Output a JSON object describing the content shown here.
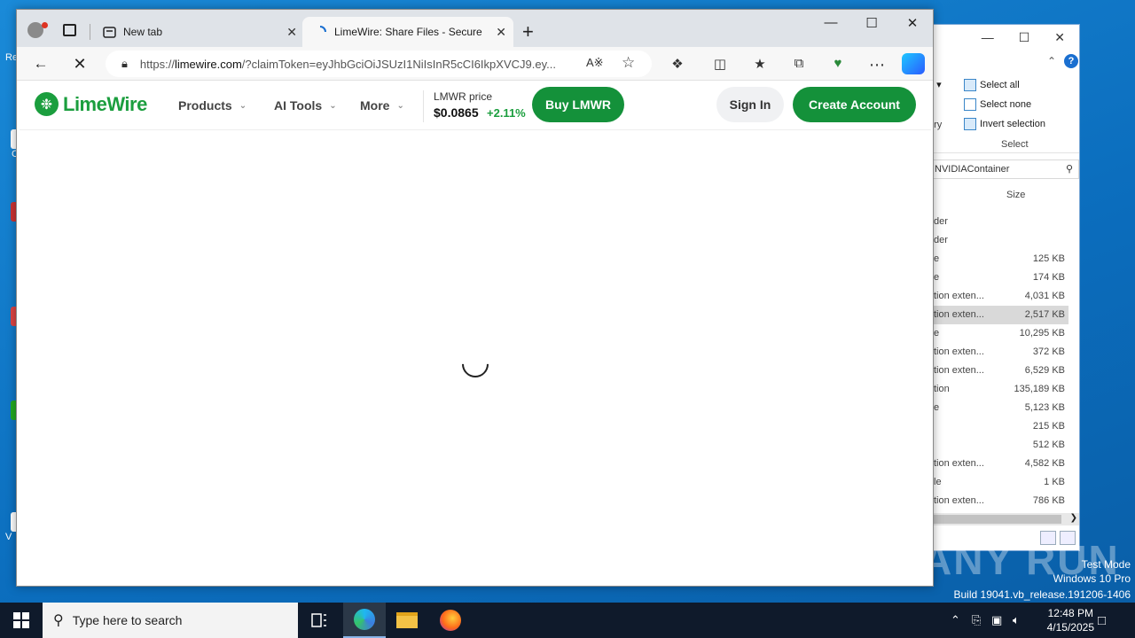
{
  "desktop": {
    "fragments": [
      "Re",
      "C",
      "V"
    ],
    "watermark": "ANY RUN",
    "sysinfo": [
      "Test Mode",
      "Windows 10 Pro",
      "Build 19041.vb_release.191206-1406"
    ]
  },
  "explorer": {
    "ribbon": {
      "dropdown_frag": "n ▾",
      "history_frag": "ory",
      "select_all": "Select all",
      "select_none": "Select none",
      "invert_selection": "Invert selection",
      "group_caption": "Select"
    },
    "search_value": "NVIDIAContainer",
    "size_header": "Size",
    "rows": [
      {
        "type": "der",
        "size": ""
      },
      {
        "type": "der",
        "size": ""
      },
      {
        "type": "e",
        "size": "125 KB"
      },
      {
        "type": "e",
        "size": "174 KB"
      },
      {
        "type": "tion exten...",
        "size": "4,031 KB"
      },
      {
        "type": "tion exten...",
        "size": "2,517 KB"
      },
      {
        "type": "e",
        "size": "10,295 KB"
      },
      {
        "type": "tion exten...",
        "size": "372 KB"
      },
      {
        "type": "tion exten...",
        "size": "6,529 KB"
      },
      {
        "type": "tion",
        "size": "135,189 KB"
      },
      {
        "type": "e",
        "size": "5,123 KB"
      },
      {
        "type": "",
        "size": "215 KB"
      },
      {
        "type": "",
        "size": "512 KB"
      },
      {
        "type": "tion exten...",
        "size": "4,582 KB"
      },
      {
        "type": "le",
        "size": "1 KB"
      },
      {
        "type": "tion exten...",
        "size": "786 KB"
      }
    ],
    "selected_row_index": 5
  },
  "browser": {
    "tabs": [
      {
        "title": "New tab"
      },
      {
        "title": "LimeWire: Share Files - Secure Fil"
      }
    ],
    "url_prefix": "https://",
    "url_domain": "limewire.com",
    "url_rest": "/?claimToken=eyJhbGciOiJSUzI1NiIsInR5cCI6IkpXVCJ9.ey..."
  },
  "limewire": {
    "logo_text": "LimeWire",
    "nav": [
      "Products",
      "AI Tools",
      "More"
    ],
    "price_label": "LMWR price",
    "price_value": "$0.0865",
    "price_change": "+2.11%",
    "buy_button": "Buy LMWR",
    "sign_in": "Sign In",
    "create_account": "Create Account"
  },
  "taskbar": {
    "search_placeholder": "Type here to search",
    "time": "12:48 PM",
    "date": "4/15/2025"
  },
  "colors": {
    "brand_green": "#14913a",
    "change_green": "#1b9e3e",
    "taskbar": "#0f1a2b"
  }
}
